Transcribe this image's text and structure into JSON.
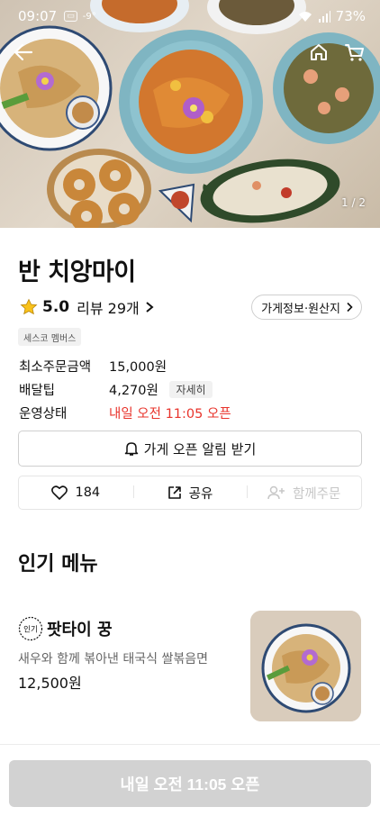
{
  "status_bar": {
    "time": "09:07",
    "extra": "-9°",
    "battery": "73%"
  },
  "hero": {
    "pager": "1 / 2"
  },
  "shop": {
    "name": "반 치앙마이",
    "rating": "5.0",
    "reviews": "리뷰 29개",
    "info_button": "가게정보·원산지",
    "tag": "세스코 멤버스"
  },
  "details": [
    {
      "label": "최소주문금액",
      "value": "15,000원"
    },
    {
      "label": "배달팁",
      "value": "4,270원",
      "chip": "자세히"
    },
    {
      "label": "운영상태",
      "value": "내일 오전 11:05 오픈"
    }
  ],
  "notify_button": "가게 오픈 알림 받기",
  "actions": {
    "likes": "184",
    "share": "공유",
    "group_order": "함께주문"
  },
  "section": {
    "title": "인기 메뉴"
  },
  "menu_items": [
    {
      "badge": "인기",
      "name": "팟타이 꿍",
      "description": "새우와 함께 볶아낸 태국식 쌀볶음면",
      "price": "12,500원"
    }
  ],
  "bottom": {
    "order_button": "내일 오전 11:05 오픈"
  },
  "colors": {
    "accent_red": "#e8332b",
    "disabled_button": "#d2d2d2"
  }
}
